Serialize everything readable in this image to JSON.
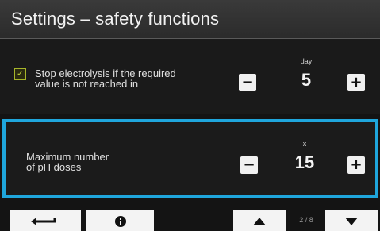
{
  "header": {
    "title": "Settings – safety functions"
  },
  "settings": [
    {
      "checked": true,
      "label_line1": "Stop electrolysis if the required",
      "label_line2": "value is not reached in",
      "unit": "day",
      "value": "5",
      "minus": "−",
      "plus": "+"
    },
    {
      "label_line1": "Maximum number",
      "label_line2": "of pH doses",
      "unit": "x",
      "value": "15",
      "minus": "−",
      "plus": "+"
    }
  ],
  "footer": {
    "back_icon": "back-arrow-icon",
    "info_icon": "info-icon",
    "up_icon": "triangle-up-icon",
    "down_icon": "triangle-down-icon",
    "page": "2 / 8"
  },
  "colors": {
    "highlight": "#1fa6dc",
    "checkbox": "#c7d63a",
    "button": "#f0f0f0"
  }
}
